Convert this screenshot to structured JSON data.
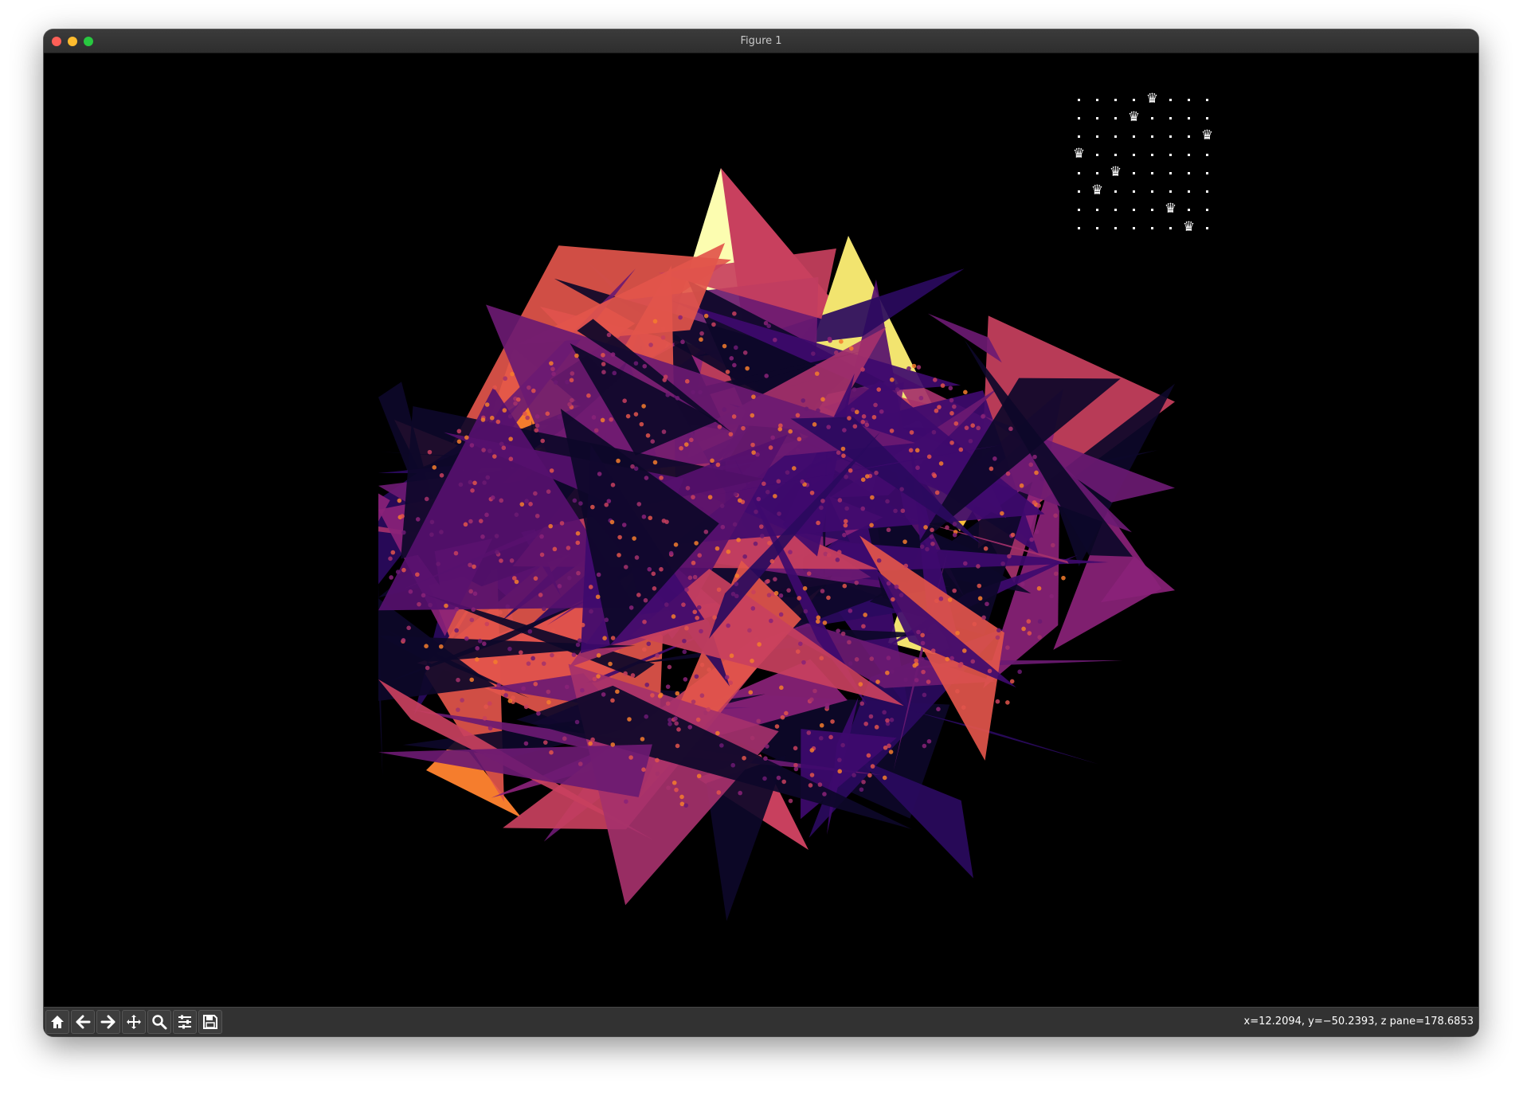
{
  "window": {
    "title": "Figure 1"
  },
  "overlay": {
    "board_size": 8,
    "queen_columns": [
      4,
      3,
      7,
      0,
      2,
      1,
      5,
      6
    ],
    "queen_glyph": "♛"
  },
  "toolbar": {
    "buttons": [
      {
        "name": "home-button",
        "icon": "home-icon"
      },
      {
        "name": "back-button",
        "icon": "arrow-left-icon"
      },
      {
        "name": "forward-button",
        "icon": "arrow-right-icon"
      },
      {
        "name": "pan-button",
        "icon": "move-icon"
      },
      {
        "name": "zoom-button",
        "icon": "magnifier-icon"
      },
      {
        "name": "configure-subplots-button",
        "icon": "sliders-icon"
      },
      {
        "name": "save-button",
        "icon": "floppy-disk-icon"
      }
    ],
    "coordinates": "x=12.2094, y=−50.2393, z pane=178.6853"
  },
  "colors": {
    "canvas_background": "#000000",
    "palette": [
      "#0d0829",
      "#2a0a5e",
      "#3e0a6e",
      "#56106e",
      "#6b1a72",
      "#8a2278",
      "#a5316b",
      "#c8405e",
      "#e2554b",
      "#f57d2d",
      "#fb9e22",
      "#fbbf3c",
      "#f2e46f",
      "#fcfdb0"
    ]
  }
}
